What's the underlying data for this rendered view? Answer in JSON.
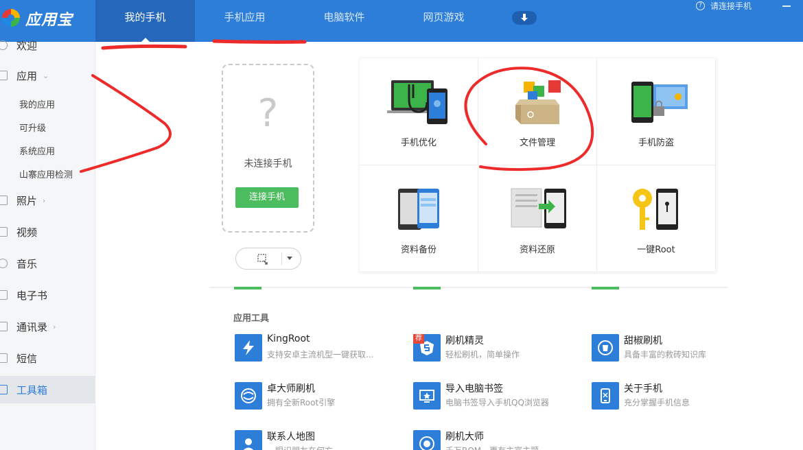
{
  "app": {
    "brand": "应用宝"
  },
  "nav": {
    "tabs": [
      {
        "label": "我的手机",
        "active": true
      },
      {
        "label": "手机应用"
      },
      {
        "label": "电脑软件"
      },
      {
        "label": "网页游戏"
      }
    ],
    "help_label": "请连接手机"
  },
  "sidebar": {
    "items": [
      {
        "label": "欢迎"
      },
      {
        "label": "应用",
        "chevron": "⌄"
      },
      {
        "label": "照片",
        "chevron": "›"
      },
      {
        "label": "视频"
      },
      {
        "label": "音乐"
      },
      {
        "label": "电子书"
      },
      {
        "label": "通讯录",
        "chevron": "›"
      },
      {
        "label": "短信"
      },
      {
        "label": "工具箱",
        "active": true
      }
    ],
    "sub_items": [
      "我的应用",
      "可升级",
      "系统应用",
      "山寨应用检测"
    ]
  },
  "phone": {
    "glyph": "?",
    "status": "未连接手机",
    "connect_label": "连接手机"
  },
  "features": [
    {
      "label": "手机优化",
      "icon": "phone-optimize-icon"
    },
    {
      "label": "文件管理",
      "icon": "file-manager-icon"
    },
    {
      "label": "手机防盗",
      "icon": "anti-theft-icon"
    },
    {
      "label": "资料备份",
      "icon": "backup-icon"
    },
    {
      "label": "资料还原",
      "icon": "restore-icon"
    },
    {
      "label": "一键Root",
      "icon": "root-key-icon"
    }
  ],
  "tools": {
    "title": "应用工具",
    "items": [
      {
        "name": "KingRoot",
        "desc": "支持安卓主流机型一键获取..."
      },
      {
        "name": "刷机精灵",
        "desc": "轻松刷机，简单操作",
        "badge": "荐"
      },
      {
        "name": "甜椒刷机",
        "desc": "具备丰富的救砖知识库"
      },
      {
        "name": "卓大师刷机",
        "desc": "拥有全新Root引擎"
      },
      {
        "name": "导入电脑书签",
        "desc": "电脑书签导入手机QQ浏览器"
      },
      {
        "name": "关于手机",
        "desc": "充分掌握手机信息"
      },
      {
        "name": "联系人地图",
        "desc": "一眼识朋友在何方"
      },
      {
        "name": "刷机大师",
        "desc": "千万ROM，更有主富主题"
      }
    ]
  },
  "colors": {
    "brand": "#2d7ed8",
    "green": "#4cbd5f",
    "annotation": "#ee2b2b"
  }
}
